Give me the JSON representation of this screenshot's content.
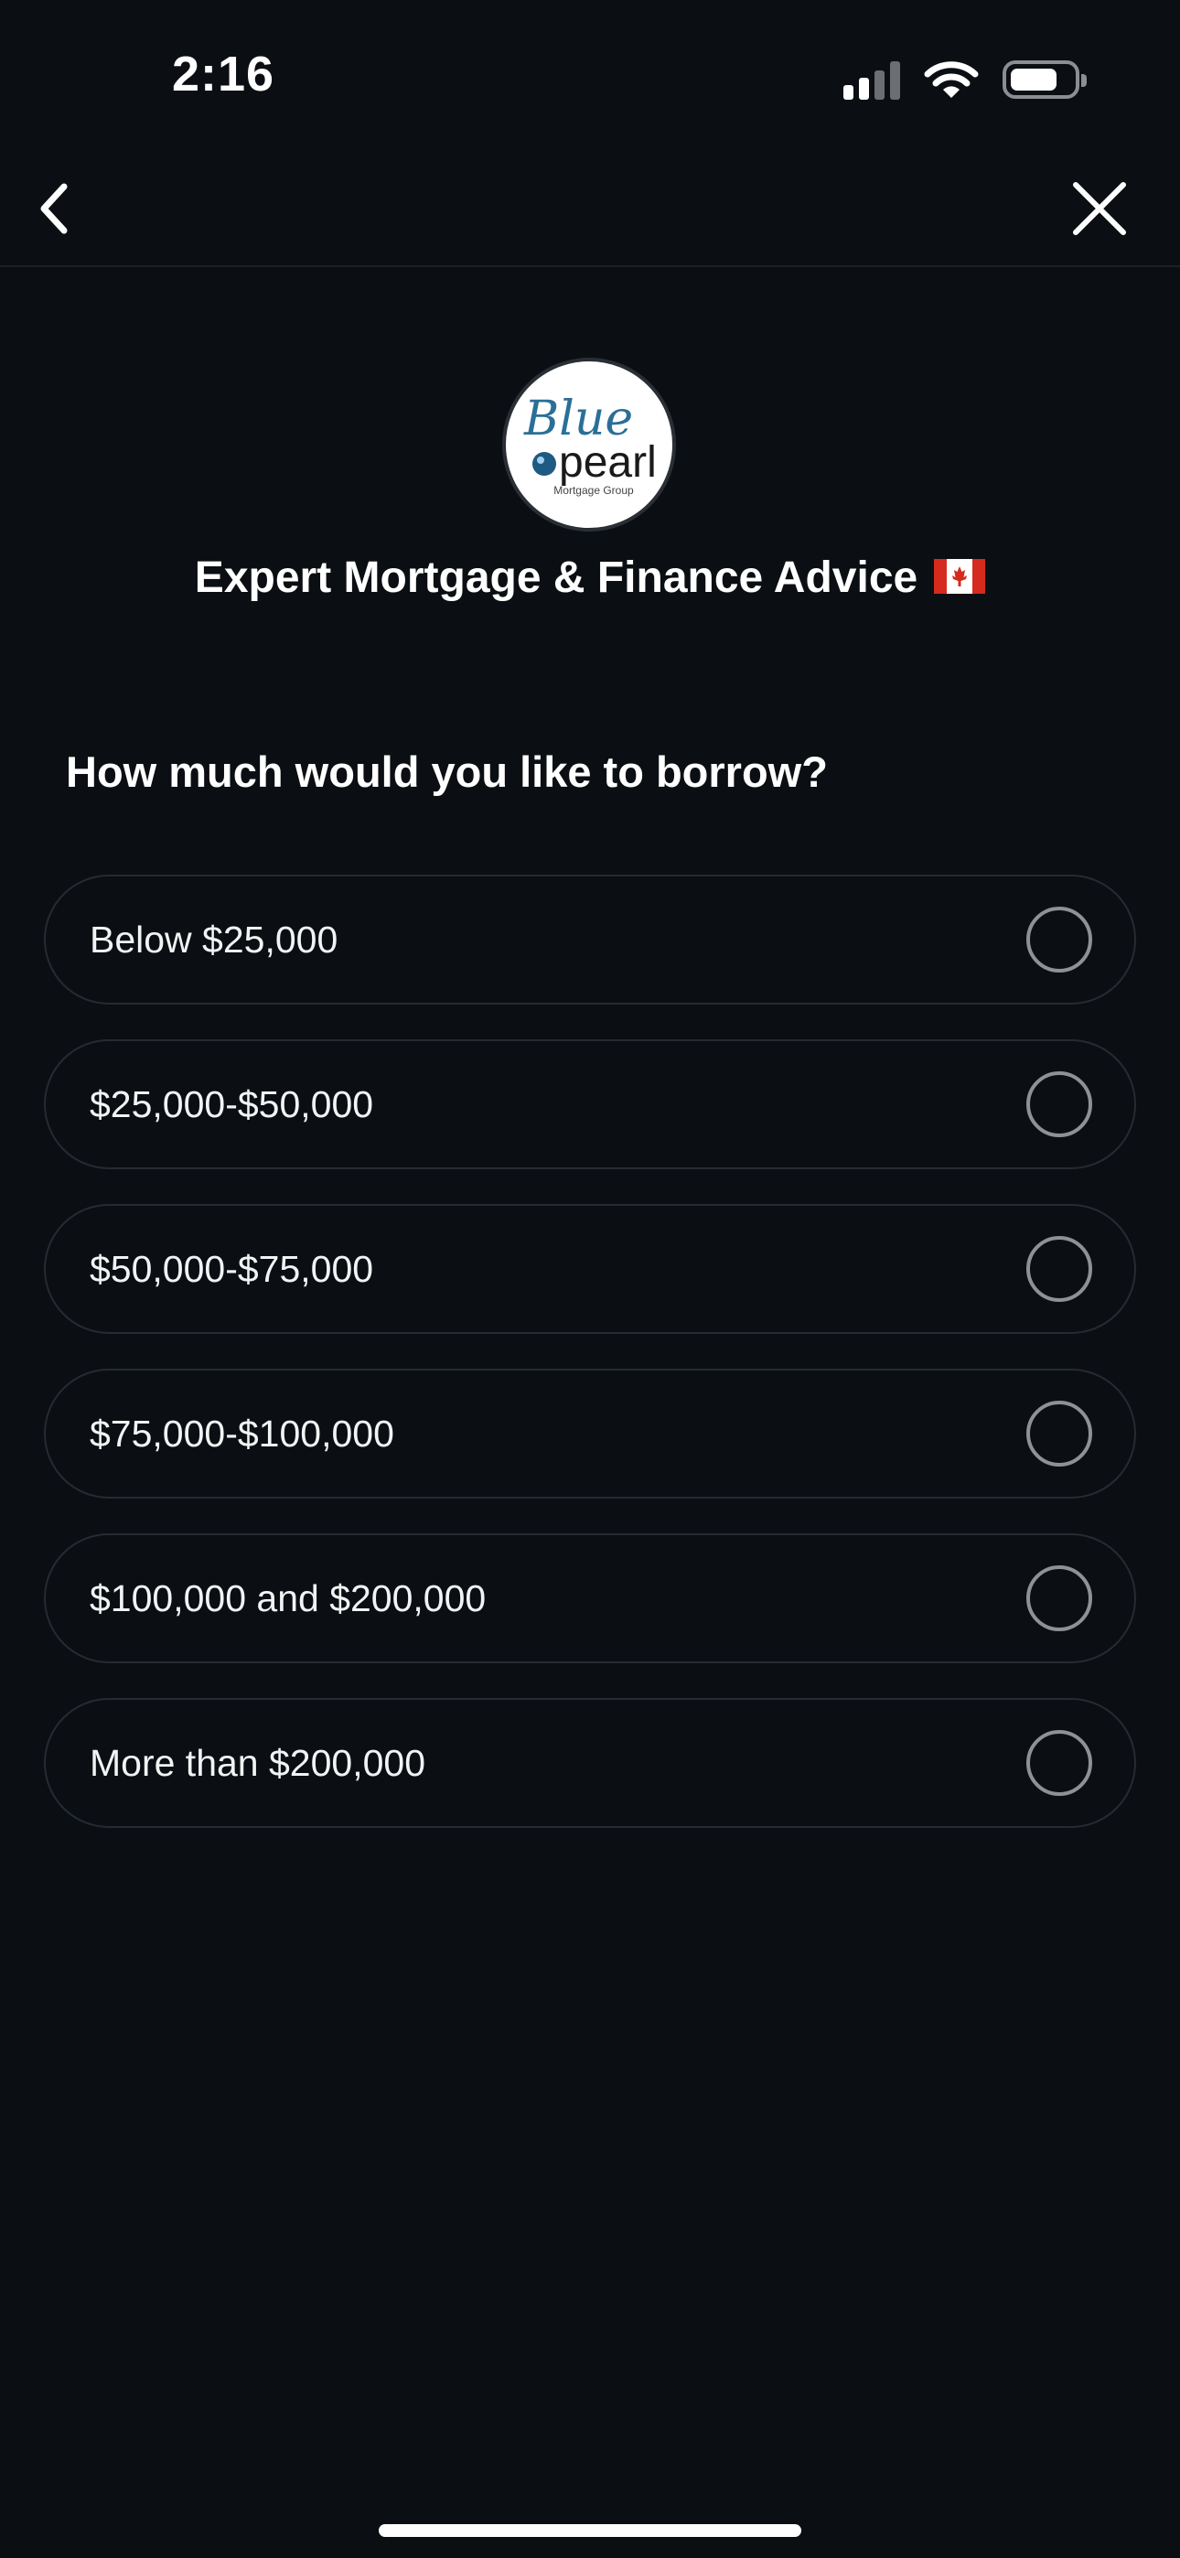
{
  "status_bar": {
    "time": "2:16"
  },
  "nav": {
    "back_icon": "chevron-left-icon",
    "close_icon": "close-icon"
  },
  "header": {
    "logo_text_script": "Blue",
    "logo_text_main": "pearl",
    "logo_text_sub": "Mortgage Group",
    "title": "Expert Mortgage & Finance Advice",
    "flag_icon": "canada-flag-icon"
  },
  "question": "How much would you like to borrow?",
  "options": [
    {
      "label": "Below $25,000"
    },
    {
      "label": "$25,000-$50,000"
    },
    {
      "label": "$50,000-$75,000"
    },
    {
      "label": "$75,000-$100,000"
    },
    {
      "label": "$100,000 and $200,000"
    },
    {
      "label": "More than $200,000"
    }
  ],
  "colors": {
    "background": "#0b0f13",
    "option_border": "#262b31",
    "radio_border": "#8e9297",
    "logo_blue": "#2a6f97",
    "flag_red": "#d52b1e"
  }
}
